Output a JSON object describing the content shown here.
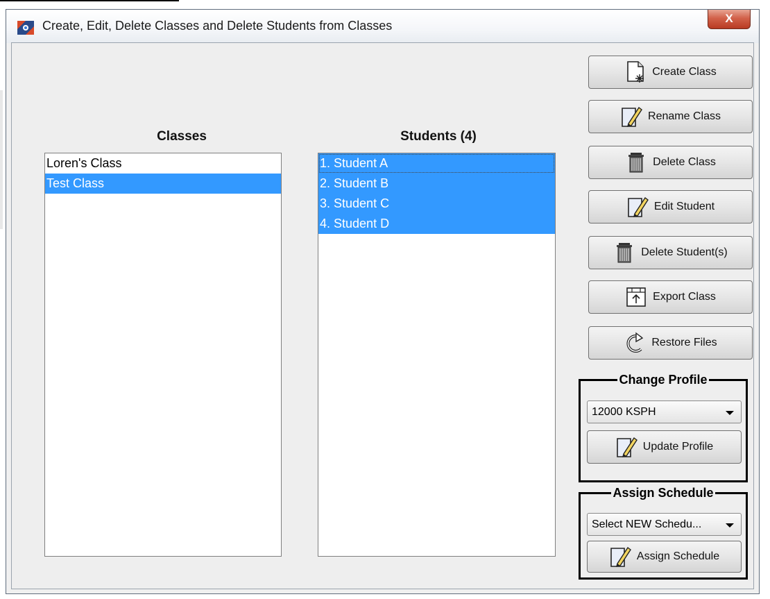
{
  "window": {
    "title": "Create, Edit, Delete Classes and Delete Students from Classes",
    "close_label": "X"
  },
  "classes": {
    "title": "Classes",
    "items": [
      {
        "label": "Loren's Class",
        "selected": false
      },
      {
        "label": "Test Class",
        "selected": true
      }
    ]
  },
  "students": {
    "title": "Students (4)",
    "items": [
      {
        "label": "1. Student A",
        "selected": true
      },
      {
        "label": "2. Student B",
        "selected": true
      },
      {
        "label": "3. Student C",
        "selected": true
      },
      {
        "label": "4. Student D",
        "selected": true
      }
    ]
  },
  "actions": {
    "create_class": "Create Class",
    "rename_class": "Rename Class",
    "delete_class": "Delete Class",
    "edit_student": "Edit Student",
    "delete_students": "Delete Student(s)",
    "export_class": "Export Class",
    "restore_files": "Restore Files"
  },
  "change_profile": {
    "legend": "Change Profile",
    "selected": "12000 KSPH",
    "button": "Update Profile"
  },
  "assign_schedule": {
    "legend": "Assign Schedule",
    "selected": "Select NEW Schedu...",
    "button": "Assign Schedule"
  },
  "colors": {
    "selection": "#3399ff",
    "window_bg": "#eeeeee",
    "close_button": "#c8503a"
  }
}
